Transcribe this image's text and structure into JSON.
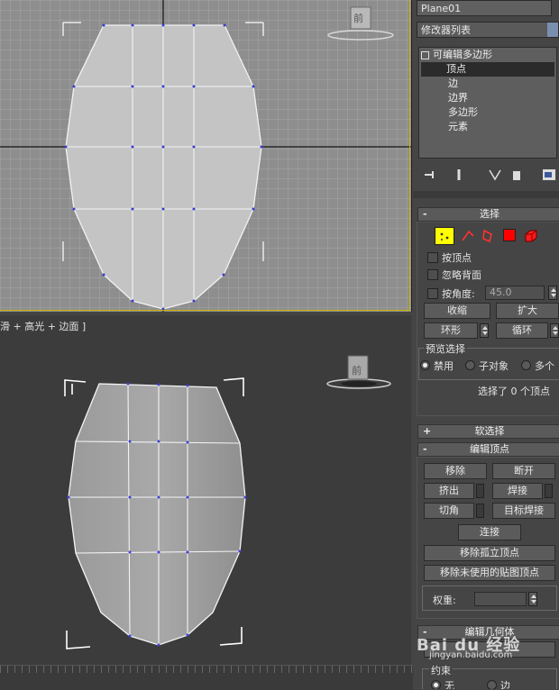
{
  "viewport_top": {
    "viewcube_label": "前"
  },
  "viewport_persp": {
    "label": "滑 + 高光 + 边面 ]",
    "viewcube_label": "前"
  },
  "panel": {
    "object_name": "Plane01",
    "modifier_list": "修改器列表",
    "stack": {
      "root": "可编辑多边形",
      "items": [
        "顶点",
        "边",
        "边界",
        "多边形",
        "元素"
      ],
      "selected_index": 0
    },
    "selection": {
      "title": "选择",
      "by_vertex": "按顶点",
      "ignore_backfacing": "忽略背面",
      "by_angle": "按角度:",
      "angle_value": "45.0",
      "shrink": "收缩",
      "grow": "扩大",
      "ring": "环形",
      "loop": "循环",
      "preview_title": "预览选择",
      "preview_options": [
        "禁用",
        "子对象",
        "多个"
      ],
      "status": "选择了 0 个顶点"
    },
    "soft_selection": {
      "title": "软选择"
    },
    "edit_vertices": {
      "title": "编辑顶点",
      "remove": "移除",
      "break": "断开",
      "extrude": "挤出",
      "weld": "焊接",
      "chamfer": "切角",
      "target_weld": "目标焊接",
      "connect": "连接",
      "remove_isolated": "移除孤立顶点",
      "remove_unused_map": "移除未使用的贴图顶点",
      "weight_label": "权重:"
    },
    "edit_geometry": {
      "title": "编辑几何体",
      "constraints": "约束",
      "options": [
        "无",
        "边"
      ]
    },
    "colors": {
      "vertex_mode_icon": "#ffff00",
      "polygon_icon": "#ff0000"
    }
  },
  "watermark": {
    "logo": "Bai du 经验",
    "url": "jingyan.baidu.com"
  }
}
